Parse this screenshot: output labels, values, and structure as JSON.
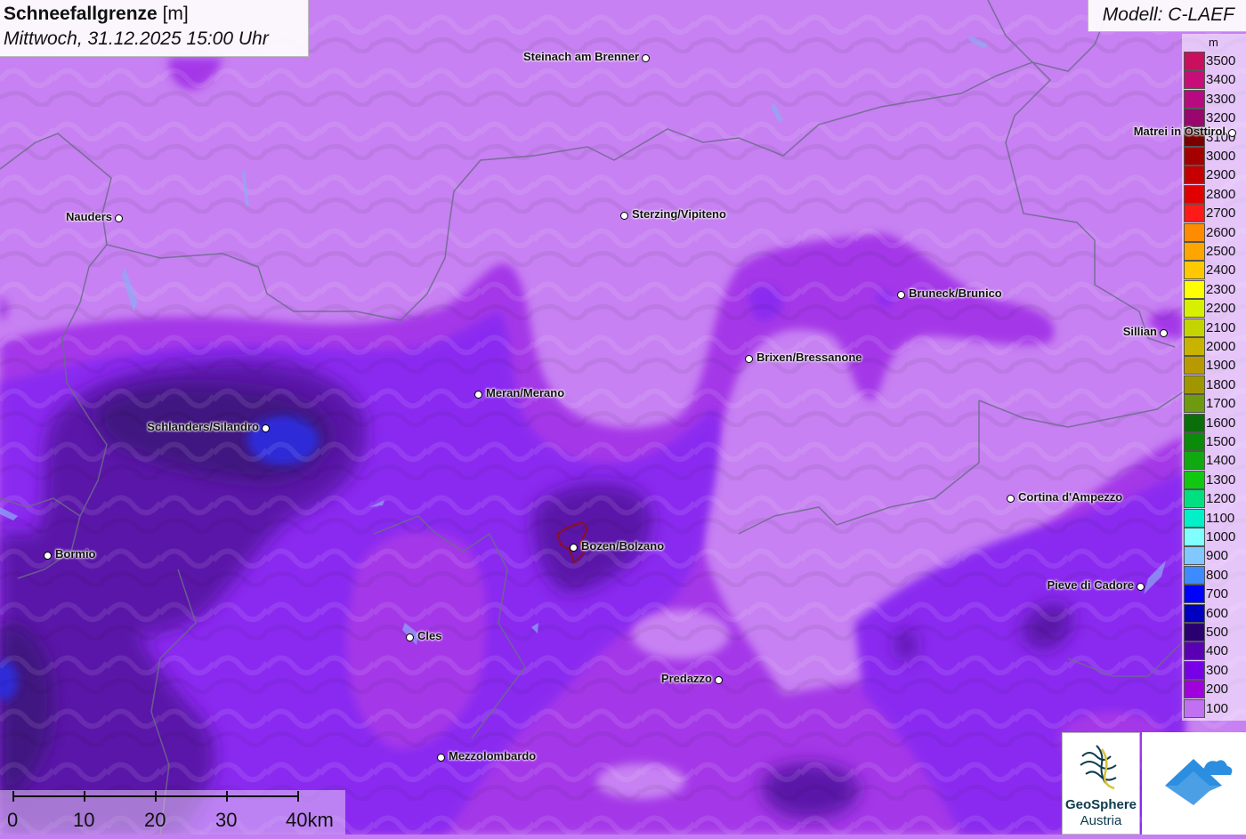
{
  "title": {
    "main": "Schneefallgrenze",
    "unit": "[m]",
    "datetime": "Mittwoch, 31.12.2025 15:00 Uhr"
  },
  "model": "Modell: C-LAEF",
  "legend": {
    "unit": "m",
    "entries": [
      {
        "label": "3500",
        "color": "#c8105e"
      },
      {
        "label": "3400",
        "color": "#c80d78"
      },
      {
        "label": "3300",
        "color": "#b80a80"
      },
      {
        "label": "3200",
        "color": "#98066e"
      },
      {
        "label": "3100",
        "color": "#7a0000"
      },
      {
        "label": "3000",
        "color": "#a30000"
      },
      {
        "label": "2900",
        "color": "#c40000"
      },
      {
        "label": "2800",
        "color": "#e00000"
      },
      {
        "label": "2700",
        "color": "#ff1a1a"
      },
      {
        "label": "2600",
        "color": "#ff8c00"
      },
      {
        "label": "2500",
        "color": "#ffa500"
      },
      {
        "label": "2400",
        "color": "#ffc800"
      },
      {
        "label": "2300",
        "color": "#ffff00"
      },
      {
        "label": "2200",
        "color": "#d8f000"
      },
      {
        "label": "2100",
        "color": "#c4d400"
      },
      {
        "label": "2000",
        "color": "#c8b400"
      },
      {
        "label": "1900",
        "color": "#b89a00"
      },
      {
        "label": "1800",
        "color": "#a09600"
      },
      {
        "label": "1700",
        "color": "#6e9a10"
      },
      {
        "label": "1600",
        "color": "#0a6e0a"
      },
      {
        "label": "1500",
        "color": "#0a8c0a"
      },
      {
        "label": "1400",
        "color": "#10aa10"
      },
      {
        "label": "1300",
        "color": "#10c810"
      },
      {
        "label": "1200",
        "color": "#00e080"
      },
      {
        "label": "1100",
        "color": "#00f0c8"
      },
      {
        "label": "1000",
        "color": "#80ffff"
      },
      {
        "label": "900",
        "color": "#80c8ff"
      },
      {
        "label": "800",
        "color": "#3c8cff"
      },
      {
        "label": "700",
        "color": "#0000ff"
      },
      {
        "label": "600",
        "color": "#0000c0"
      },
      {
        "label": "500",
        "color": "#2a0070"
      },
      {
        "label": "400",
        "color": "#5a00b4"
      },
      {
        "label": "300",
        "color": "#7800e6"
      },
      {
        "label": "200",
        "color": "#a000dc"
      },
      {
        "label": "100",
        "color": "#c070f0"
      }
    ]
  },
  "places": [
    {
      "name": "Steinach am Brenner",
      "side": "left"
    },
    {
      "name": "Nauders",
      "side": "left"
    },
    {
      "name": "Sterzing/Vipiteno",
      "side": "right"
    },
    {
      "name": "Matrei in Osttirol",
      "side": "left"
    },
    {
      "name": "Bruneck/Brunico",
      "side": "right"
    },
    {
      "name": "Sillian",
      "side": "left"
    },
    {
      "name": "Brixen/Bressanone",
      "side": "right"
    },
    {
      "name": "Meran/Merano",
      "side": "right"
    },
    {
      "name": "Schlanders/Silandro",
      "side": "left"
    },
    {
      "name": "Cortina d'Ampezzo",
      "side": "right"
    },
    {
      "name": "Bozen/Bolzano",
      "side": "right"
    },
    {
      "name": "Bormio",
      "side": "right"
    },
    {
      "name": "Pieve di Cadore",
      "side": "left"
    },
    {
      "name": "Cles",
      "side": "right"
    },
    {
      "name": "Predazzo",
      "side": "left"
    },
    {
      "name": "Mezzolombardo",
      "side": "right"
    }
  ],
  "scalebar": {
    "labels": [
      "0",
      "10",
      "20",
      "30",
      "40km"
    ]
  },
  "logos": {
    "geosphere_line1": "GeoSphere",
    "geosphere_line2": "Austria"
  }
}
